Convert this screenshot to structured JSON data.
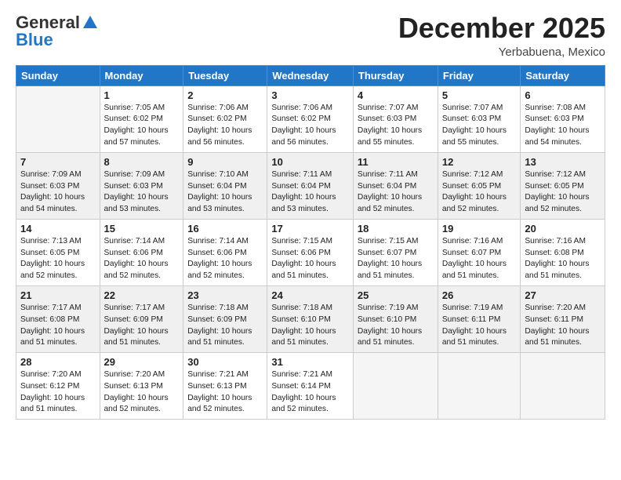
{
  "header": {
    "logo_general": "General",
    "logo_blue": "Blue",
    "month_title": "December 2025",
    "location": "Yerbabuena, Mexico"
  },
  "columns": [
    "Sunday",
    "Monday",
    "Tuesday",
    "Wednesday",
    "Thursday",
    "Friday",
    "Saturday"
  ],
  "weeks": [
    [
      {
        "day": "",
        "info": ""
      },
      {
        "day": "1",
        "info": "Sunrise: 7:05 AM\nSunset: 6:02 PM\nDaylight: 10 hours\nand 57 minutes."
      },
      {
        "day": "2",
        "info": "Sunrise: 7:06 AM\nSunset: 6:02 PM\nDaylight: 10 hours\nand 56 minutes."
      },
      {
        "day": "3",
        "info": "Sunrise: 7:06 AM\nSunset: 6:02 PM\nDaylight: 10 hours\nand 56 minutes."
      },
      {
        "day": "4",
        "info": "Sunrise: 7:07 AM\nSunset: 6:03 PM\nDaylight: 10 hours\nand 55 minutes."
      },
      {
        "day": "5",
        "info": "Sunrise: 7:07 AM\nSunset: 6:03 PM\nDaylight: 10 hours\nand 55 minutes."
      },
      {
        "day": "6",
        "info": "Sunrise: 7:08 AM\nSunset: 6:03 PM\nDaylight: 10 hours\nand 54 minutes."
      }
    ],
    [
      {
        "day": "7",
        "info": "Sunrise: 7:09 AM\nSunset: 6:03 PM\nDaylight: 10 hours\nand 54 minutes."
      },
      {
        "day": "8",
        "info": "Sunrise: 7:09 AM\nSunset: 6:03 PM\nDaylight: 10 hours\nand 53 minutes."
      },
      {
        "day": "9",
        "info": "Sunrise: 7:10 AM\nSunset: 6:04 PM\nDaylight: 10 hours\nand 53 minutes."
      },
      {
        "day": "10",
        "info": "Sunrise: 7:11 AM\nSunset: 6:04 PM\nDaylight: 10 hours\nand 53 minutes."
      },
      {
        "day": "11",
        "info": "Sunrise: 7:11 AM\nSunset: 6:04 PM\nDaylight: 10 hours\nand 52 minutes."
      },
      {
        "day": "12",
        "info": "Sunrise: 7:12 AM\nSunset: 6:05 PM\nDaylight: 10 hours\nand 52 minutes."
      },
      {
        "day": "13",
        "info": "Sunrise: 7:12 AM\nSunset: 6:05 PM\nDaylight: 10 hours\nand 52 minutes."
      }
    ],
    [
      {
        "day": "14",
        "info": "Sunrise: 7:13 AM\nSunset: 6:05 PM\nDaylight: 10 hours\nand 52 minutes."
      },
      {
        "day": "15",
        "info": "Sunrise: 7:14 AM\nSunset: 6:06 PM\nDaylight: 10 hours\nand 52 minutes."
      },
      {
        "day": "16",
        "info": "Sunrise: 7:14 AM\nSunset: 6:06 PM\nDaylight: 10 hours\nand 52 minutes."
      },
      {
        "day": "17",
        "info": "Sunrise: 7:15 AM\nSunset: 6:06 PM\nDaylight: 10 hours\nand 51 minutes."
      },
      {
        "day": "18",
        "info": "Sunrise: 7:15 AM\nSunset: 6:07 PM\nDaylight: 10 hours\nand 51 minutes."
      },
      {
        "day": "19",
        "info": "Sunrise: 7:16 AM\nSunset: 6:07 PM\nDaylight: 10 hours\nand 51 minutes."
      },
      {
        "day": "20",
        "info": "Sunrise: 7:16 AM\nSunset: 6:08 PM\nDaylight: 10 hours\nand 51 minutes."
      }
    ],
    [
      {
        "day": "21",
        "info": "Sunrise: 7:17 AM\nSunset: 6:08 PM\nDaylight: 10 hours\nand 51 minutes."
      },
      {
        "day": "22",
        "info": "Sunrise: 7:17 AM\nSunset: 6:09 PM\nDaylight: 10 hours\nand 51 minutes."
      },
      {
        "day": "23",
        "info": "Sunrise: 7:18 AM\nSunset: 6:09 PM\nDaylight: 10 hours\nand 51 minutes."
      },
      {
        "day": "24",
        "info": "Sunrise: 7:18 AM\nSunset: 6:10 PM\nDaylight: 10 hours\nand 51 minutes."
      },
      {
        "day": "25",
        "info": "Sunrise: 7:19 AM\nSunset: 6:10 PM\nDaylight: 10 hours\nand 51 minutes."
      },
      {
        "day": "26",
        "info": "Sunrise: 7:19 AM\nSunset: 6:11 PM\nDaylight: 10 hours\nand 51 minutes."
      },
      {
        "day": "27",
        "info": "Sunrise: 7:20 AM\nSunset: 6:11 PM\nDaylight: 10 hours\nand 51 minutes."
      }
    ],
    [
      {
        "day": "28",
        "info": "Sunrise: 7:20 AM\nSunset: 6:12 PM\nDaylight: 10 hours\nand 51 minutes."
      },
      {
        "day": "29",
        "info": "Sunrise: 7:20 AM\nSunset: 6:13 PM\nDaylight: 10 hours\nand 52 minutes."
      },
      {
        "day": "30",
        "info": "Sunrise: 7:21 AM\nSunset: 6:13 PM\nDaylight: 10 hours\nand 52 minutes."
      },
      {
        "day": "31",
        "info": "Sunrise: 7:21 AM\nSunset: 6:14 PM\nDaylight: 10 hours\nand 52 minutes."
      },
      {
        "day": "",
        "info": ""
      },
      {
        "day": "",
        "info": ""
      },
      {
        "day": "",
        "info": ""
      }
    ]
  ]
}
